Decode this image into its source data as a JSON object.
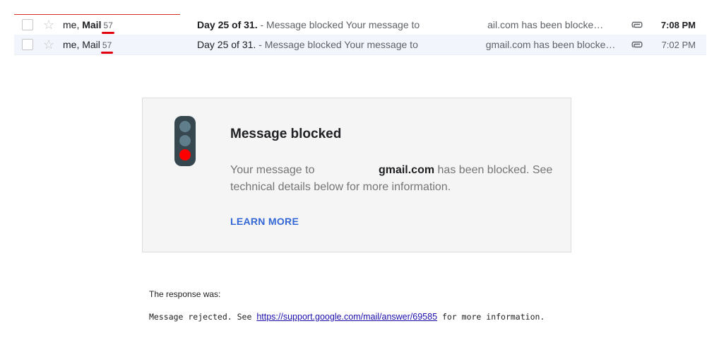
{
  "inbox": {
    "rows": [
      {
        "sender_prefix": "me, ",
        "sender_bold": "Mail",
        "count": "57",
        "subject": "Day 25 of 31.",
        "snippet_start": " - Message blocked Your message to ",
        "snippet_end": "ail.com has been blocke…",
        "time": "7:08 PM"
      },
      {
        "sender_prefix": "me, ",
        "sender_bold": "Mail",
        "count": "57",
        "subject": "Day 25 of 31.",
        "snippet_start": " - Message blocked Your message to ",
        "snippet_end": "gmail.com has been blocke…",
        "time": "7:02 PM"
      }
    ]
  },
  "card": {
    "title": "Message blocked",
    "text_before": "Your message to ",
    "email_suffix": "gmail.com",
    "text_after": " has been blocked. See technical details below for more information.",
    "learn_more": "LEARN MORE"
  },
  "response": {
    "label": "The response was:",
    "prefix": "Message rejected. See ",
    "link": "https://support.google.com/mail/answer/69585",
    "suffix": " for more information."
  },
  "colors": {
    "alert_red": "#ff0000",
    "link_blue": "#3367d6"
  }
}
